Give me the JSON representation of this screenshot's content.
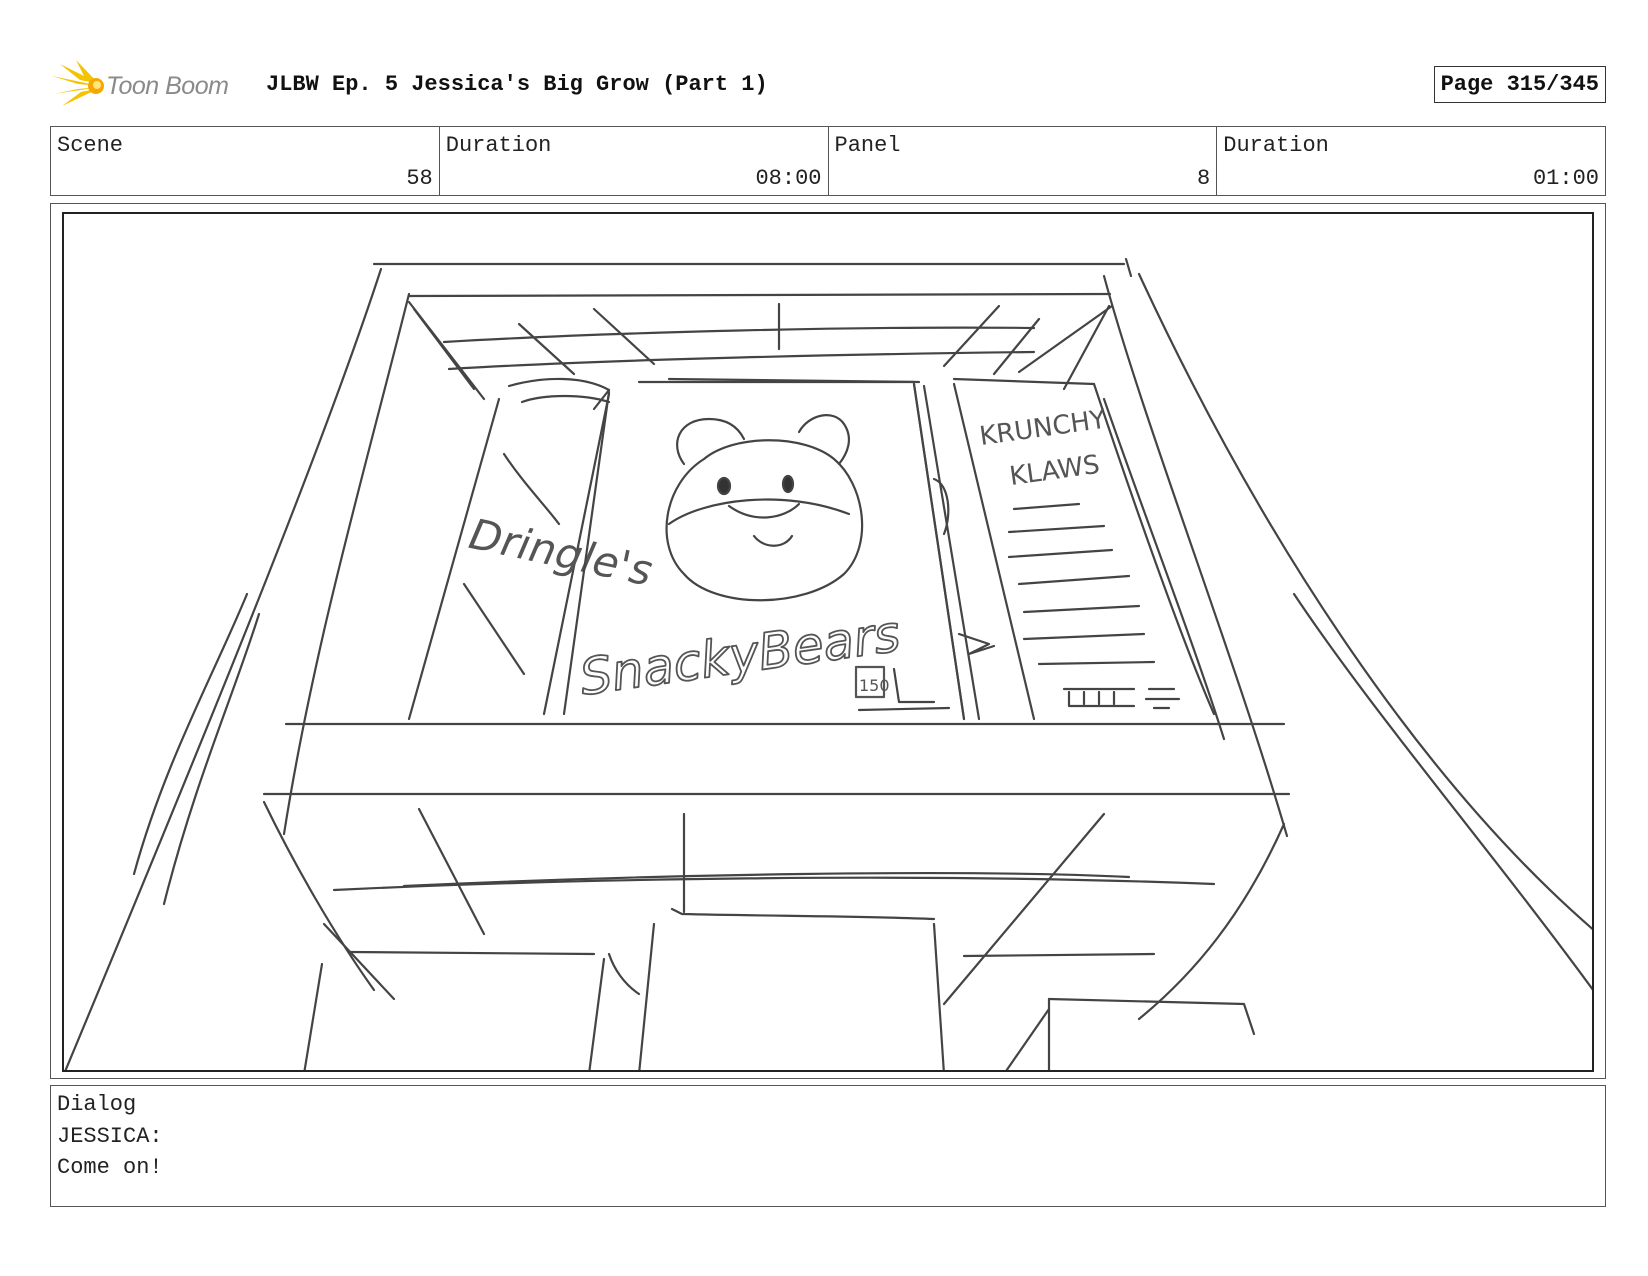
{
  "header": {
    "logo_text": "Toon Boom",
    "title": "JLBW Ep. 5 Jessica's Big Grow (Part 1)",
    "page": "Page 315/345"
  },
  "info": {
    "scene_label": "Scene",
    "scene_value": "58",
    "scene_duration_label": "Duration",
    "scene_duration_value": "08:00",
    "panel_label": "Panel",
    "panel_value": "8",
    "panel_duration_label": "Duration",
    "panel_duration_value": "01:00"
  },
  "sketch": {
    "box_left_text": "Dringle's",
    "box_center_text": "SnackyBears",
    "box_right_text_1": "KRUNCHY",
    "box_right_text_2": "KLAWS",
    "price_tag": "150"
  },
  "dialog": {
    "label": "Dialog",
    "speaker": "JESSICA:",
    "line": "Come on!"
  }
}
